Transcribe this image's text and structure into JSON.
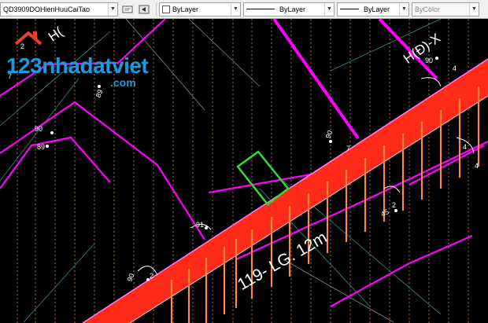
{
  "toolbar": {
    "file_combo": "QD3909DOHienHuuCaiTao",
    "color_combo": "ByLayer",
    "color_value": "#ffffff",
    "linetype_combo": "ByLayer",
    "lineweight_combo": "ByLayer",
    "plotstyle_combo": "ByColor"
  },
  "watermark": {
    "brand": "123nhadatviet",
    "domain": ".com"
  },
  "drawing": {
    "road_label": "119- LG. 12m",
    "label_top_left": "H(",
    "label_top_right": "H(Đ)-X",
    "dims": [
      "90",
      "89",
      "90",
      "89",
      "90",
      "91",
      "45",
      "90",
      "2",
      "4",
      "4",
      "7",
      "2",
      "4",
      "2",
      "7"
    ],
    "colors": {
      "parcel_line": "#ff00ff",
      "road_fill": "#ff2a1a",
      "road_hatch": "#ff8a3c",
      "highlight": "#33dd33",
      "grid": "#e8a060"
    }
  }
}
